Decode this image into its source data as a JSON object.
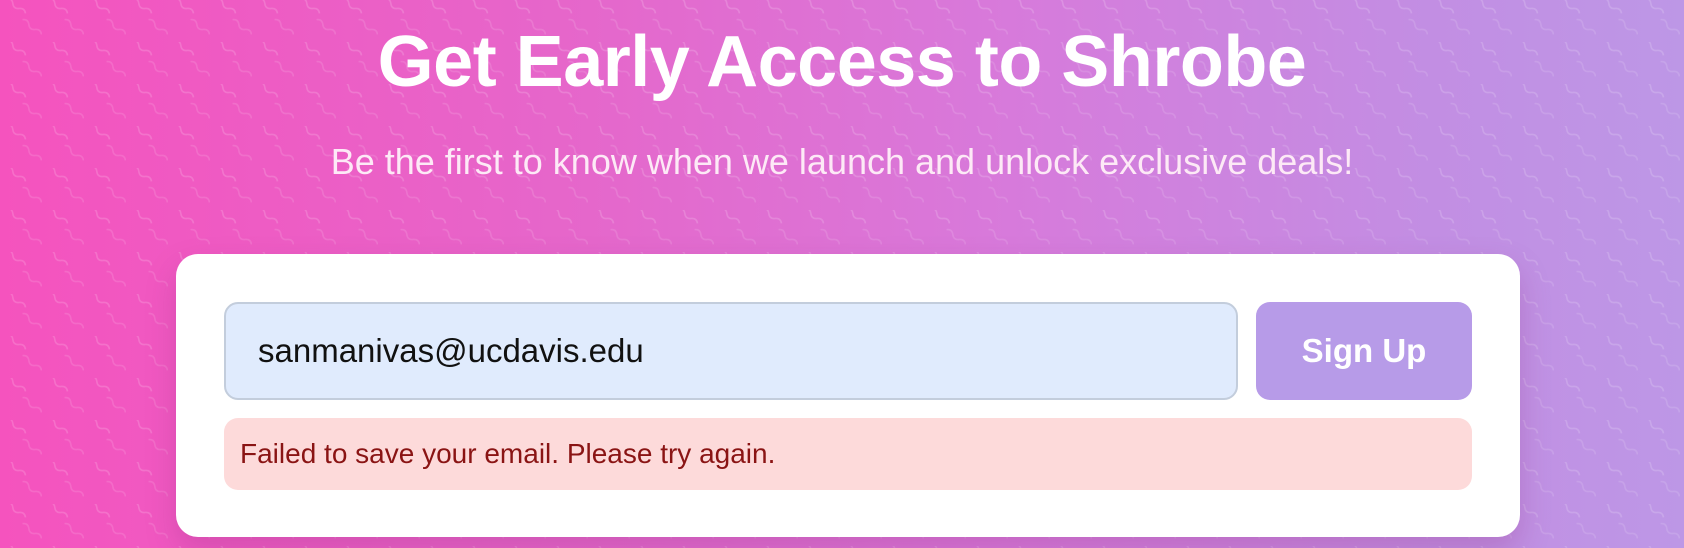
{
  "hero": {
    "title": "Get Early Access to Shrobe",
    "subtitle": "Be the first to know when we launch and unlock exclusive deals!"
  },
  "signup_form": {
    "email_value": "sanmanivas@ucdavis.edu",
    "submit_label": "Sign Up",
    "error_message": "Failed to save your email. Please try again."
  },
  "colors": {
    "gradient_start": "#f553be",
    "gradient_end": "#bd97e6",
    "button": "#b79be8",
    "input_background": "#e0ebfd",
    "error_background": "#fddada",
    "error_text": "#8a1414"
  }
}
